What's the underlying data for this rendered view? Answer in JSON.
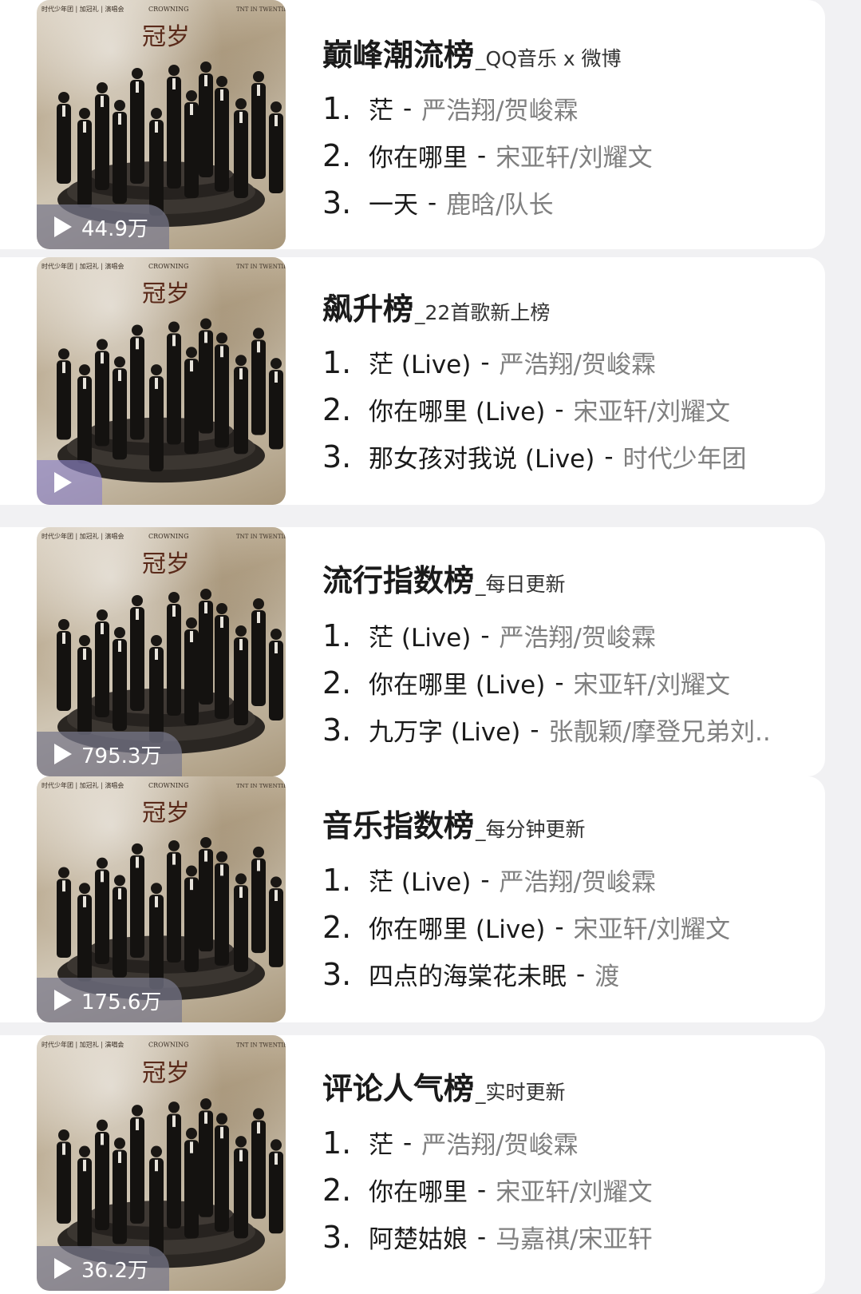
{
  "cover": {
    "header_left": "时代少年团 | 加冠礼 | 演唱会",
    "header_mid": "CROWNING",
    "header_right": "TNT IN TWENTIES",
    "art_title": "冠岁"
  },
  "charts": [
    {
      "name": "巅峰潮流榜",
      "subtitle": "_QQ音乐 x 微博",
      "play_count": "44.9万",
      "play_blurred": false,
      "songs": [
        {
          "rank": "1.",
          "title": "茫",
          "artist": "严浩翔/贺峻霖"
        },
        {
          "rank": "2.",
          "title": "你在哪里",
          "artist": "宋亚轩/刘耀文"
        },
        {
          "rank": "3.",
          "title": "一天",
          "artist": "鹿晗/队长"
        }
      ]
    },
    {
      "name": "飙升榜",
      "subtitle": "_22首歌新上榜",
      "play_count": "",
      "play_blurred": true,
      "songs": [
        {
          "rank": "1.",
          "title": "茫 (Live)",
          "artist": "严浩翔/贺峻霖"
        },
        {
          "rank": "2.",
          "title": "你在哪里 (Live)",
          "artist": "宋亚轩/刘耀文"
        },
        {
          "rank": "3.",
          "title": "那女孩对我说 (Live)",
          "artist": "时代少年团"
        }
      ]
    },
    {
      "name": "流行指数榜",
      "subtitle": "_每日更新",
      "play_count": "795.3万",
      "play_blurred": false,
      "songs": [
        {
          "rank": "1.",
          "title": "茫 (Live)",
          "artist": "严浩翔/贺峻霖"
        },
        {
          "rank": "2.",
          "title": "你在哪里 (Live)",
          "artist": "宋亚轩/刘耀文"
        },
        {
          "rank": "3.",
          "title": "九万字 (Live)",
          "artist": "张靓颖/摩登兄弟刘.."
        }
      ]
    },
    {
      "name": "音乐指数榜",
      "subtitle": "_每分钟更新",
      "play_count": "175.6万",
      "play_blurred": false,
      "songs": [
        {
          "rank": "1.",
          "title": "茫 (Live)",
          "artist": "严浩翔/贺峻霖"
        },
        {
          "rank": "2.",
          "title": "你在哪里 (Live)",
          "artist": "宋亚轩/刘耀文"
        },
        {
          "rank": "3.",
          "title": "四点的海棠花未眠",
          "artist": "渡"
        }
      ]
    },
    {
      "name": "评论人气榜",
      "subtitle": "_实时更新",
      "play_count": "36.2万",
      "play_blurred": false,
      "songs": [
        {
          "rank": "1.",
          "title": "茫",
          "artist": "严浩翔/贺峻霖"
        },
        {
          "rank": "2.",
          "title": "你在哪里",
          "artist": "宋亚轩/刘耀文"
        },
        {
          "rank": "3.",
          "title": "阿楚姑娘",
          "artist": "马嘉祺/宋亚轩"
        }
      ]
    }
  ],
  "separator": "-"
}
